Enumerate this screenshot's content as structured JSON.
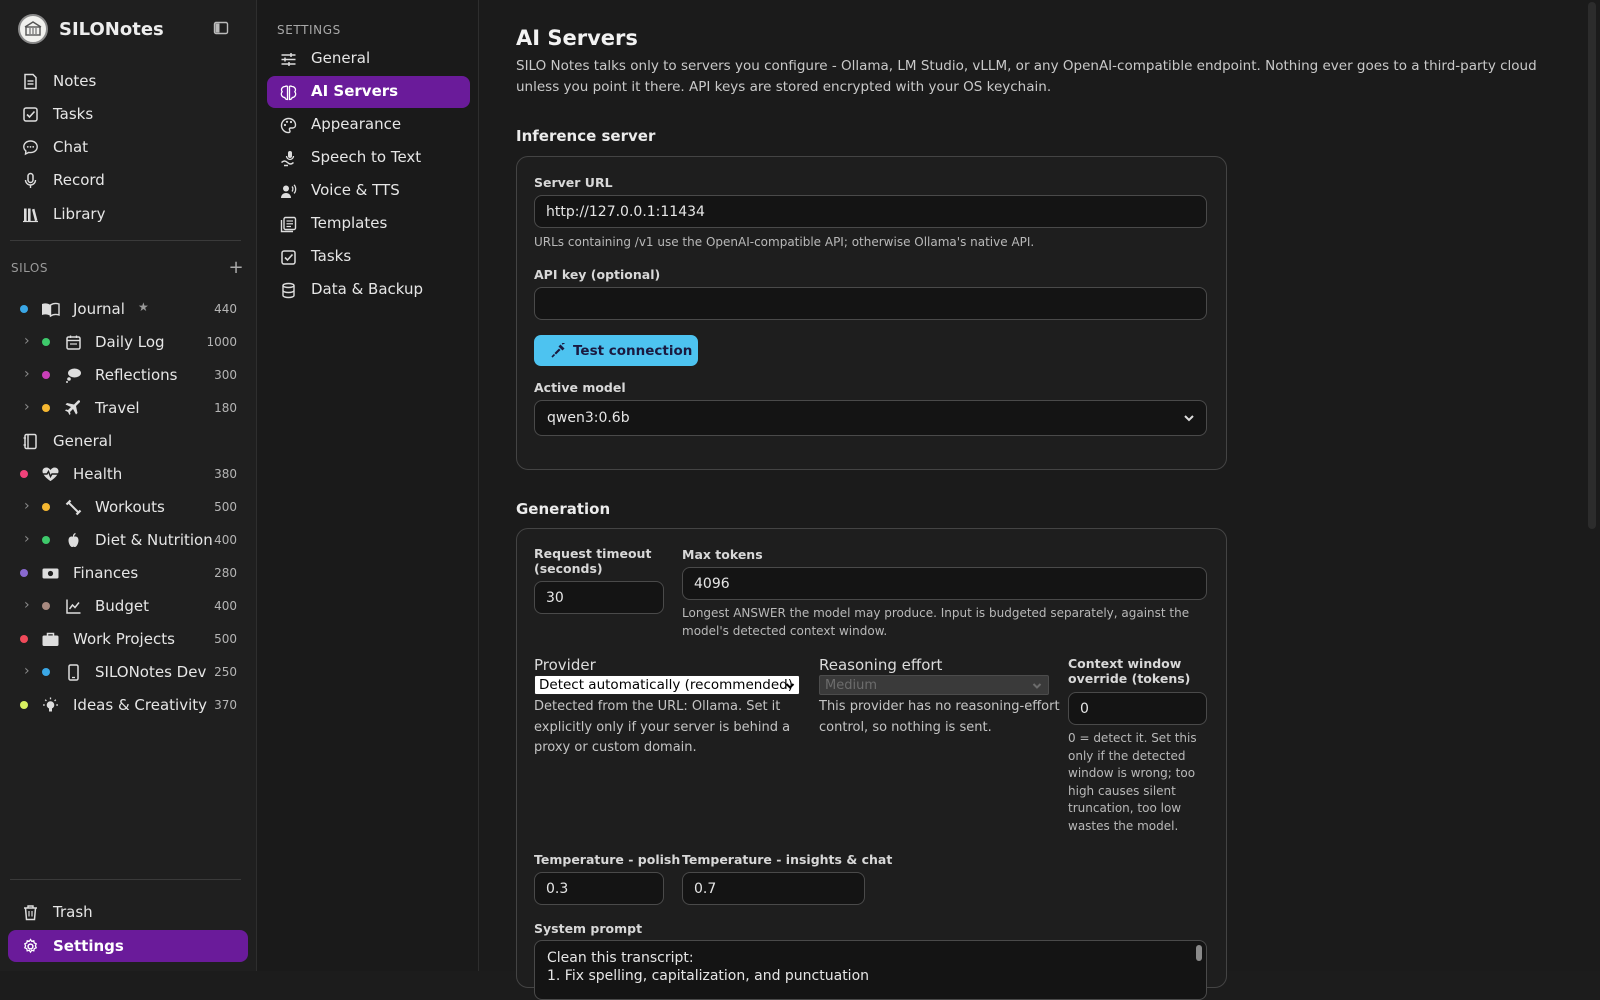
{
  "app": {
    "name": "SILONotes"
  },
  "nav": [
    {
      "label": "Notes",
      "icon": "notes-icon"
    },
    {
      "label": "Tasks",
      "icon": "tasks-icon"
    },
    {
      "label": "Chat",
      "icon": "chat-icon"
    },
    {
      "label": "Record",
      "icon": "microphone-icon"
    },
    {
      "label": "Library",
      "icon": "library-icon"
    }
  ],
  "silos": {
    "header": "SILOS",
    "add": "+",
    "items": [
      {
        "label": "Journal",
        "count": "440",
        "color": "#3aa7e6",
        "icon": "book-icon",
        "starred": "★",
        "level": 0
      },
      {
        "label": "Daily Log",
        "count": "1000",
        "color": "#3ec96b",
        "icon": "calendar-icon",
        "level": 1
      },
      {
        "label": "Reflections",
        "count": "300",
        "color": "#c93fb8",
        "icon": "thought-icon",
        "level": 1
      },
      {
        "label": "Travel",
        "count": "180",
        "color": "#f5b731",
        "icon": "plane-icon",
        "level": 1
      },
      {
        "label": "General",
        "count": "",
        "color": "",
        "icon": "notebook-icon",
        "level": -1
      },
      {
        "label": "Health",
        "count": "380",
        "color": "#f0427a",
        "icon": "heartbeat-icon",
        "level": 0
      },
      {
        "label": "Workouts",
        "count": "500",
        "color": "#f5b731",
        "icon": "dumbbell-icon",
        "level": 1
      },
      {
        "label": "Diet & Nutrition",
        "count": "400",
        "color": "#3ec96b",
        "icon": "apple-icon",
        "level": 1
      },
      {
        "label": "Finances",
        "count": "280",
        "color": "#8a6ad0",
        "icon": "money-icon",
        "level": 0
      },
      {
        "label": "Budget",
        "count": "400",
        "color": "#a88a80",
        "icon": "chart-line-icon",
        "level": 1
      },
      {
        "label": "Work Projects",
        "count": "500",
        "color": "#f04a5a",
        "icon": "briefcase-icon",
        "level": 0
      },
      {
        "label": "SILONotes Dev",
        "count": "250",
        "color": "#3aa7e6",
        "icon": "phone-icon",
        "level": 1
      },
      {
        "label": "Ideas & Creativity",
        "count": "370",
        "color": "#d8f060",
        "icon": "lightbulb-icon",
        "level": 0
      }
    ]
  },
  "bottom_nav": {
    "trash": "Trash",
    "settings": "Settings"
  },
  "settings_nav": {
    "header": "SETTINGS",
    "items": [
      {
        "label": "General"
      },
      {
        "label": "AI Servers"
      },
      {
        "label": "Appearance"
      },
      {
        "label": "Speech to Text"
      },
      {
        "label": "Voice & TTS"
      },
      {
        "label": "Templates"
      },
      {
        "label": "Tasks"
      },
      {
        "label": "Data & Backup"
      }
    ],
    "active_index": 1
  },
  "page": {
    "title": "AI Servers",
    "intro": "SILO Notes talks only to servers you configure - Ollama, LM Studio, vLLM, or any OpenAI-compatible endpoint. Nothing ever goes to a third-party cloud unless you point it there. API keys are stored encrypted with your OS keychain."
  },
  "inference": {
    "heading": "Inference server",
    "server_url_label": "Server URL",
    "server_url": "http://127.0.0.1:11434",
    "server_url_help": "URLs containing /v1 use the OpenAI-compatible API; otherwise Ollama's native API.",
    "api_key_label": "API key (optional)",
    "api_key": "",
    "test_button": "Test connection",
    "active_model_label": "Active model",
    "active_model": "qwen3:0.6b"
  },
  "generation": {
    "heading": "Generation",
    "timeout_label_1": "Request timeout",
    "timeout_label_2": "(seconds)",
    "timeout": "30",
    "max_tokens_label": "Max tokens",
    "max_tokens": "4096",
    "max_tokens_help_1": "Longest ANSWER the model may produce. Input is budgeted separately, against the",
    "max_tokens_help_2": "model's detected context window.",
    "provider_label": "Provider",
    "provider": "Detect automatically (recommended)",
    "provider_help_1": "Detected from the URL: Ollama. Set it",
    "provider_help_2": "explicitly only if your server is behind a",
    "provider_help_3": "proxy or custom domain.",
    "reasoning_label": "Reasoning effort",
    "reasoning": "Medium",
    "reasoning_help_1": "This provider has no reasoning-effort",
    "reasoning_help_2": "control, so nothing is sent.",
    "context_label_1": "Context window",
    "context_label_2": "override (tokens)",
    "context": "0",
    "context_help_1": "0 = detect it. Set this",
    "context_help_2": "only if the detected",
    "context_help_3": "window is wrong; too",
    "context_help_4": "high causes silent",
    "context_help_5": "truncation, too low",
    "context_help_6": "wastes the model.",
    "temp_polish_label": "Temperature - polish",
    "temp_polish": "0.3",
    "temp_insights_label": "Temperature - insights & chat",
    "temp_insights": "0.7",
    "system_prompt_label": "System prompt",
    "system_prompt_line1": "Clean this transcript:",
    "system_prompt_line2": "1. Fix spelling, capitalization, and punctuation"
  },
  "colors": {
    "accent": "#6a1b9a",
    "test_button": "#4dc3f0"
  }
}
